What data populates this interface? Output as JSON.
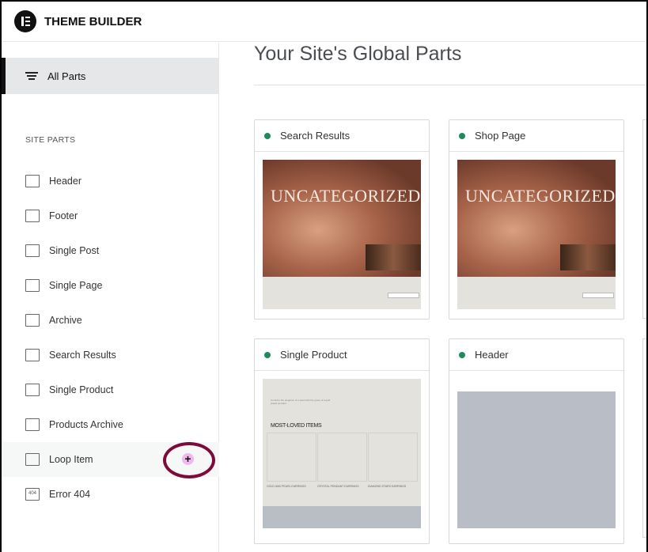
{
  "app": {
    "title": "THEME BUILDER"
  },
  "sidebar": {
    "all_parts": "All Parts",
    "section_label": "SITE PARTS",
    "items": [
      {
        "label": "Header",
        "icon": "header-icon"
      },
      {
        "label": "Footer",
        "icon": "footer-icon"
      },
      {
        "label": "Single Post",
        "icon": "single-post-icon"
      },
      {
        "label": "Single Page",
        "icon": "single-page-icon"
      },
      {
        "label": "Archive",
        "icon": "archive-icon"
      },
      {
        "label": "Search Results",
        "icon": "search-results-icon"
      },
      {
        "label": "Single Product",
        "icon": "single-product-icon"
      },
      {
        "label": "Products Archive",
        "icon": "products-archive-icon"
      },
      {
        "label": "Loop Item",
        "icon": "loop-item-icon",
        "highlighted": true,
        "add_button": "+"
      },
      {
        "label": "Error 404",
        "icon": "error-404-icon",
        "icon_text": "404"
      }
    ]
  },
  "main": {
    "title": "Your Site's Global Parts",
    "cards": [
      {
        "title": "Search Results",
        "status_color": "#1e8a5c",
        "preview_text": "UNCATEGORIZED"
      },
      {
        "title": "Shop Page",
        "status_color": "#1e8a5c",
        "preview_text": "UNCATEGORIZED"
      },
      {
        "title": "Single Product",
        "status_color": "#1e8a5c",
        "preview_heading": "MOST-LOVED ITEMS",
        "products": [
          "GOLD AND PEARL EARRINGS",
          "CRYSTAL PENDANT EARRINGS",
          "DIAMOND STARS EARRINGS"
        ]
      },
      {
        "title": "Header",
        "status_color": "#1e8a5c"
      }
    ]
  },
  "colors": {
    "accent_ring": "#7c0a3a",
    "add_button": "#f0b8f0",
    "status": "#1e8a5c"
  }
}
